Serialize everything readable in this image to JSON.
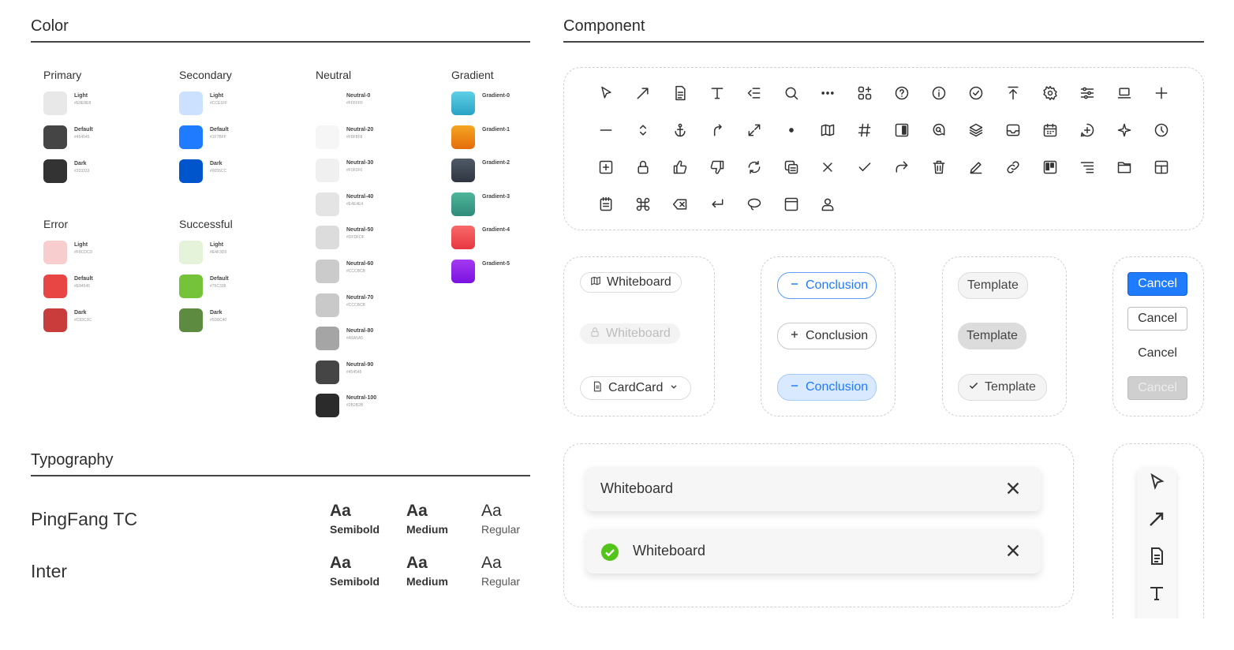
{
  "sections": {
    "color": "Color",
    "component": "Component",
    "typography": "Typography"
  },
  "color": {
    "primary": {
      "label": "Primary",
      "swatches": [
        {
          "name": "Light",
          "hex": "#E8E8E8",
          "color": "#e8e8e8"
        },
        {
          "name": "Default",
          "hex": "#454545",
          "color": "#454545"
        },
        {
          "name": "Dark",
          "hex": "#333333",
          "color": "#333333"
        }
      ]
    },
    "secondary": {
      "label": "Secondary",
      "swatches": [
        {
          "name": "Light",
          "hex": "#CCE1FF",
          "color": "#cce1ff"
        },
        {
          "name": "Default",
          "hex": "#1F7BFF",
          "color": "#1f7bff"
        },
        {
          "name": "Dark",
          "hex": "#0055CC",
          "color": "#0055cc"
        }
      ]
    },
    "error": {
      "label": "Error",
      "swatches": [
        {
          "name": "Light",
          "hex": "#F8CDCD",
          "color": "#f8cdcd"
        },
        {
          "name": "Default",
          "hex": "#E84545",
          "color": "#e84545"
        },
        {
          "name": "Dark",
          "hex": "#C83C3C",
          "color": "#c83c3c"
        }
      ]
    },
    "successful": {
      "label": "Successful",
      "swatches": [
        {
          "name": "Light",
          "hex": "#E4F3D9",
          "color": "#e4f3d9"
        },
        {
          "name": "Default",
          "hex": "#75C338",
          "color": "#75c338"
        },
        {
          "name": "Dark",
          "hex": "#5D8C40",
          "color": "#5d8c40"
        }
      ]
    },
    "neutral": {
      "label": "Neutral",
      "swatches": [
        {
          "name": "Neutral-0",
          "hex": "#FFFFFF",
          "color": "#ffffff"
        },
        {
          "name": "Neutral-20",
          "hex": "#F8F8F8",
          "color": "#f6f6f6"
        },
        {
          "name": "Neutral-30",
          "hex": "#F0F0F0",
          "color": "#f0f0f0"
        },
        {
          "name": "Neutral-40",
          "hex": "#E4E4E4",
          "color": "#e4e4e4"
        },
        {
          "name": "Neutral-50",
          "hex": "#DFDFDF",
          "color": "#dcdcdc"
        },
        {
          "name": "Neutral-60",
          "hex": "#CCCBCB",
          "color": "#cccbcb"
        },
        {
          "name": "Neutral-70",
          "hex": "#CCCBCB",
          "color": "#c9c9c9"
        },
        {
          "name": "Neutral-80",
          "hex": "#A5A5A5",
          "color": "#a5a5a5"
        },
        {
          "name": "Neutral-90",
          "hex": "#454545",
          "color": "#454545"
        },
        {
          "name": "Neutral-100",
          "hex": "#2B2B2B",
          "color": "#2b2b2b"
        }
      ]
    },
    "gradient": {
      "label": "Gradient",
      "swatches": [
        {
          "name": "Gradient-0",
          "from": "#2aa3c4",
          "to": "#5fd0e6"
        },
        {
          "name": "Gradient-1",
          "from": "#e56b0a",
          "to": "#f5a623"
        },
        {
          "name": "Gradient-2",
          "from": "#2f3641",
          "to": "#505a68"
        },
        {
          "name": "Gradient-3",
          "from": "#2f8a7a",
          "to": "#4fb69a"
        },
        {
          "name": "Gradient-4",
          "from": "#e8363f",
          "to": "#f76a6a"
        },
        {
          "name": "Gradient-5",
          "from": "#7a12e0",
          "to": "#a43af0"
        }
      ]
    }
  },
  "typography": {
    "fonts": [
      {
        "name": "PingFang  TC",
        "samples": [
          {
            "aa": "Aa",
            "weight": "Semibold"
          },
          {
            "aa": "Aa",
            "weight": "Medium"
          },
          {
            "aa": "Aa",
            "weight": "Regular"
          }
        ]
      },
      {
        "name": "Inter",
        "samples": [
          {
            "aa": "Aa",
            "weight": "Semibold"
          },
          {
            "aa": "Aa",
            "weight": "Medium"
          },
          {
            "aa": "Aa",
            "weight": "Regular"
          }
        ]
      }
    ]
  },
  "icons": [
    "cursor-icon",
    "arrow-icon",
    "document-icon",
    "text-icon",
    "outdent-icon",
    "search-icon",
    "more-icon",
    "apps-icon",
    "help-icon",
    "info-icon",
    "check-circle-icon",
    "upload-top-icon",
    "settings-icon",
    "sliders-icon",
    "laptop-icon",
    "plus-icon",
    "minus-icon",
    "sort-icon",
    "anchor-icon",
    "redo-curve-icon",
    "expand-icon",
    "dot-icon",
    "map-icon",
    "hash-icon",
    "sidebar-icon",
    "chat-search-icon",
    "layers-icon",
    "inbox-icon",
    "calendar-icon",
    "add-circle-icon",
    "sparkle-icon",
    "clock-icon",
    "add-square-icon",
    "lock-icon",
    "thumbs-up-icon",
    "thumbs-down-icon",
    "refresh-icon",
    "copy-icon",
    "close-icon",
    "check-icon",
    "forward-icon",
    "trash-icon",
    "pen-icon",
    "link-icon",
    "kanban-icon",
    "list-indent-icon",
    "folder-tab-icon",
    "layout-icon",
    "notepad-icon",
    "command-icon",
    "backspace-icon",
    "enter-icon",
    "lasso-icon",
    "window-icon",
    "user-icon"
  ],
  "chips": {
    "whiteboard_default": "Whiteboard",
    "whiteboard_disabled": "Whiteboard",
    "cardcard": "CardCard",
    "conclusion_1": "Conclusion",
    "conclusion_2": "Conclusion",
    "conclusion_3": "Conclusion",
    "template_1": "Template",
    "template_2": "Template",
    "template_3": "Template"
  },
  "buttons": {
    "primary": "Cancel",
    "outline": "Cancel",
    "text": "Cancel",
    "disabled": "Cancel"
  },
  "toasts": {
    "plain": "Whiteboard",
    "success": "Whiteboard"
  },
  "colors": {
    "accent": "#1f7bff",
    "accent_light": "#d4e6ff",
    "success": "#52c41a",
    "chip_bg": "#f0f0f0",
    "disabled_btn": "#cfcfcf"
  }
}
